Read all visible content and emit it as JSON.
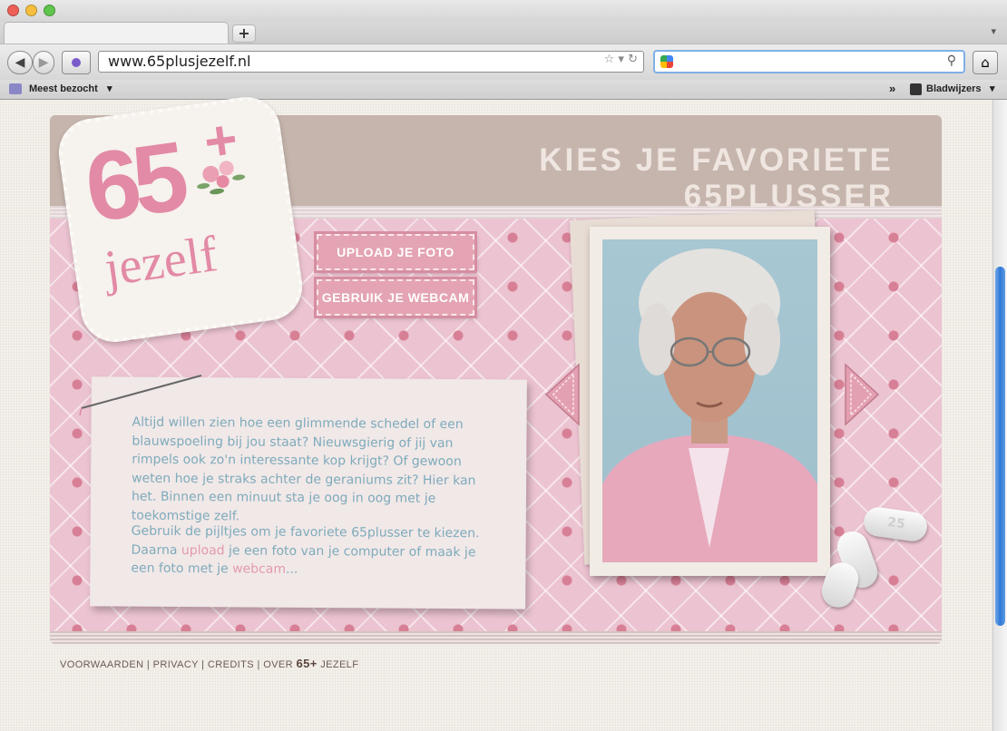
{
  "browser": {
    "url": "www.65plusjezelf.nl",
    "new_tab": "+",
    "tab_menu": "▾",
    "back": "◀",
    "forward": "▶",
    "reload": "↻",
    "home": "⌂",
    "search_value": "",
    "bookmarks_left": "Meest bezocht",
    "bookmarks_right": "Bladwijzers",
    "chevrons": "»"
  },
  "page": {
    "title": "KIES JE FAVORIETE 65PLUSSER",
    "logo": {
      "top": "65",
      "plus": "+",
      "bottom": "jezelf"
    },
    "buttons": {
      "upload": "UPLOAD JE FOTO",
      "webcam": "GEBRUIK JE WEBCAM"
    },
    "intro": "Altijd willen zien hoe een glimmende schedel of een blauwspoeling bij jou staat? Nieuwsgierig of jij van rimpels ook zo'n interessante kop krijgt? Of gewoon weten hoe je straks achter de geraniums zit? Hier kan het. Binnen een minuut sta je oog in oog met je toekomstige zelf.",
    "instructions": {
      "part1": "Gebruik de pijltjes om je favoriete 65plusser te kiezen. Daarna ",
      "upload_link": "upload",
      "part2": " je een foto van je computer of maak je een foto met je ",
      "webcam_link": "webcam",
      "part3": "..."
    },
    "pill_text": "25"
  },
  "footer": {
    "voorwaarden": "VOORWAARDEN",
    "privacy": "PRIVACY",
    "credits": "CREDITS",
    "over": "OVER",
    "brand": "65+",
    "brand_suffix": "JEZELF",
    "sep": "|"
  },
  "colors": {
    "accent": "#e4a4b3",
    "banner": "#c6b5ad",
    "text": "#7eabbb"
  }
}
